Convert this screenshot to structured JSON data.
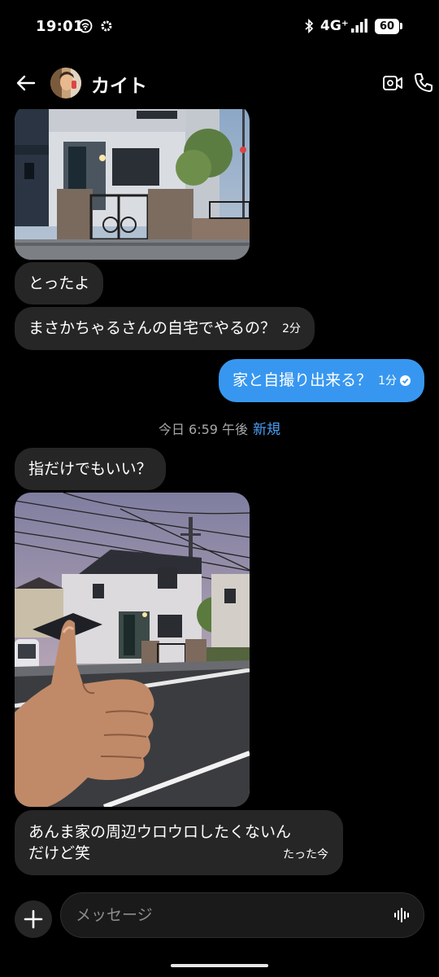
{
  "status_bar": {
    "time": "19:01",
    "network": "4G⁺",
    "battery": "60"
  },
  "header": {
    "contact_name": "カイト"
  },
  "messages": [
    {
      "text": "とったよ"
    },
    {
      "text": "まさかちゃるさんの自宅でやるの？",
      "time": "2分"
    },
    {
      "text": "家と自撮り出来る？",
      "time": "1分"
    },
    {
      "text": "指だけでもいい？"
    },
    {
      "line1": "あんま家の周辺ウロウロしたくないん",
      "line2": "だけど笑",
      "time": "たった今"
    }
  ],
  "day_separator": {
    "label": "今日 6:59 午後",
    "new_label": "新規"
  },
  "composer": {
    "placeholder": "メッセージ"
  },
  "colors": {
    "outgoing_bubble": "#3797f0",
    "incoming_bubble": "#262626",
    "background": "#000000",
    "new_label": "#4a9ff5"
  }
}
